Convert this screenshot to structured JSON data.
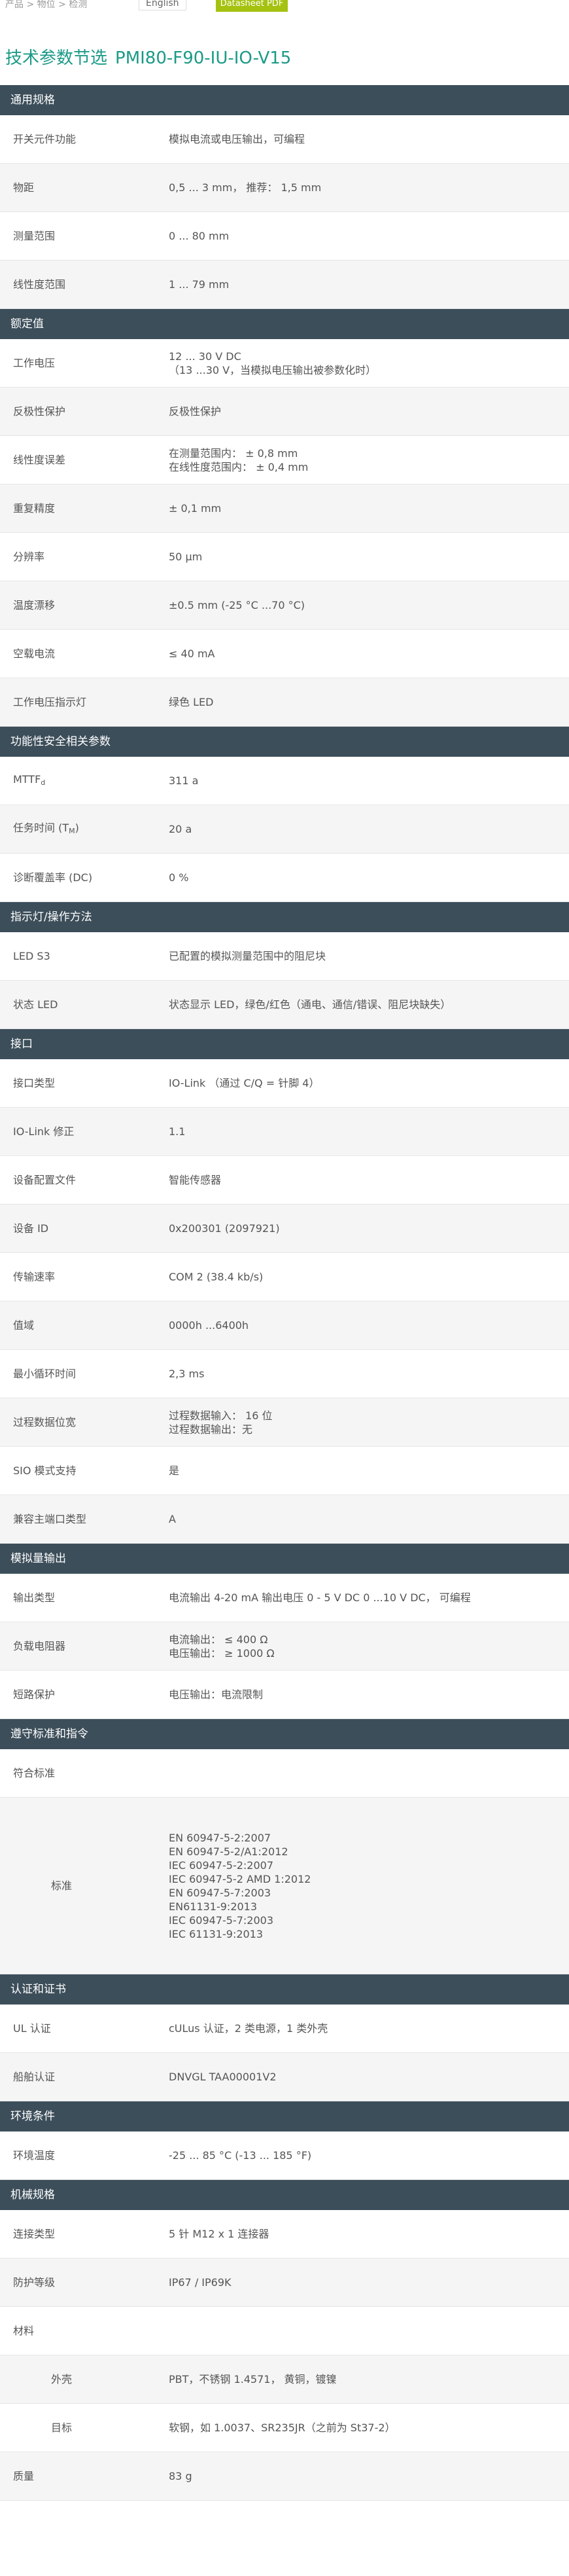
{
  "topbar": {
    "crumb": "产品 > 物位 > 检测",
    "lang": "English",
    "button": "Datasheet PDF"
  },
  "title": {
    "prefix": "技术参数节选",
    "product": "PMI80-F90-IU-IO-V15"
  },
  "sections": [
    {
      "title": "通用规格",
      "rows": [
        {
          "label": "开关元件功能",
          "values": [
            "模拟电流或电压输出，可编程"
          ]
        },
        {
          "label": "物距",
          "values": [
            "0,5 ... 3 mm， 推荐： 1,5 mm"
          ]
        },
        {
          "label": "测量范围",
          "values": [
            "0 ... 80 mm"
          ]
        },
        {
          "label": "线性度范围",
          "values": [
            "1 ... 79 mm"
          ]
        }
      ]
    },
    {
      "title": "额定值",
      "rows": [
        {
          "label": "工作电压",
          "values": [
            "12 ... 30 V DC",
            "（13 ...30 V，当模拟电压输出被参数化时）"
          ]
        },
        {
          "label": "反极性保护",
          "values": [
            "反极性保护"
          ]
        },
        {
          "label": "线性度误差",
          "values": [
            "在测量范围内： ± 0,8 mm",
            "在线性度范围内： ± 0,4 mm"
          ]
        },
        {
          "label": "重复精度",
          "values": [
            "± 0,1 mm"
          ]
        },
        {
          "label": "分辨率",
          "values": [
            "50 μm"
          ]
        },
        {
          "label": "温度漂移",
          "values": [
            "±0.5 mm (-25 °C ...70 °C)"
          ]
        },
        {
          "label": "空载电流",
          "values": [
            "≤ 40 mA"
          ]
        },
        {
          "label": "工作电压指示灯",
          "values": [
            "绿色 LED"
          ]
        }
      ]
    },
    {
      "title": "功能性安全相关参数",
      "rows": [
        {
          "label": "MTTF",
          "label_sub": "d",
          "values": [
            "311 a"
          ]
        },
        {
          "label": "任务时间 (T",
          "label_sub": "M",
          "label_suffix": ")",
          "values": [
            "20 a"
          ]
        },
        {
          "label": "诊断覆盖率 (DC)",
          "values": [
            "0 %"
          ]
        }
      ]
    },
    {
      "title": "指示灯/操作方法",
      "rows": [
        {
          "label": "LED S3",
          "values": [
            "已配置的模拟测量范围中的阻尼块"
          ]
        },
        {
          "label": "状态 LED",
          "values": [
            "状态显示 LED，绿色/红色（通电、通信/错误、阻尼块缺失）"
          ]
        }
      ]
    },
    {
      "title": "接口",
      "rows": [
        {
          "label": "接口类型",
          "values": [
            "IO-Link （通过 C/Q = 针脚 4）"
          ]
        },
        {
          "label": "IO-Link 修正",
          "values": [
            "1.1"
          ]
        },
        {
          "label": "设备配置文件",
          "values": [
            "智能传感器"
          ]
        },
        {
          "label": "设备 ID",
          "values": [
            "0x200301 (2097921)"
          ]
        },
        {
          "label": "传输速率",
          "values": [
            "COM 2 (38.4 kb/s)"
          ]
        },
        {
          "label": "值域",
          "values": [
            "0000h ...6400h"
          ]
        },
        {
          "label": "最小循环时间",
          "values": [
            "2,3 ms"
          ]
        },
        {
          "label": "过程数据位宽",
          "values": [
            "过程数据输入： 16 位",
            "过程数据输出：无"
          ]
        },
        {
          "label": "SIO 模式支持",
          "values": [
            "是"
          ]
        },
        {
          "label": "兼容主端口类型",
          "values": [
            "A"
          ]
        }
      ]
    },
    {
      "title": "模拟量输出",
      "rows": [
        {
          "label": "输出类型",
          "values": [
            "电流输出 4-20 mA 输出电压 0 - 5 V DC 0 ...10 V DC， 可编程"
          ]
        },
        {
          "label": "负载电阻器",
          "values": [
            "电流输出： ≤ 400 Ω",
            "电压输出： ≥ 1000 Ω"
          ]
        },
        {
          "label": "短路保护",
          "values": [
            "电压输出：电流限制"
          ]
        }
      ]
    },
    {
      "title": "遵守标准和指令",
      "rows": [
        {
          "label": "符合标准",
          "values": []
        },
        {
          "label": "标准",
          "indent": true,
          "values": [
            "EN 60947-5-2:2007",
            "EN 60947-5-2/A1:2012",
            "IEC 60947-5-2:2007",
            "IEC 60947-5-2 AMD 1:2012",
            "EN 60947-5-7:2003",
            "EN61131-9:2013",
            "IEC 60947-5-7:2003",
            "IEC 61131-9:2013"
          ]
        }
      ]
    },
    {
      "title": "认证和证书",
      "rows": [
        {
          "label": "UL 认证",
          "values": [
            "cULus 认证，2 类电源，1 类外壳"
          ]
        },
        {
          "label": "船舶认证",
          "values": [
            "DNVGL TAA00001V2"
          ]
        }
      ]
    },
    {
      "title": "环境条件",
      "rows": [
        {
          "label": "环境温度",
          "values": [
            "-25 ... 85 °C (-13 ... 185 °F)"
          ]
        }
      ]
    },
    {
      "title": "机械规格",
      "rows": [
        {
          "label": "连接类型",
          "values": [
            "5 针 M12 x 1 连接器"
          ]
        },
        {
          "label": "防护等级",
          "values": [
            "IP67 / IP69K"
          ]
        },
        {
          "label": "材料",
          "values": []
        },
        {
          "label": "外壳",
          "indent": true,
          "values": [
            "PBT，不锈钢 1.4571， 黄铜，镀镍"
          ]
        },
        {
          "label": "目标",
          "indent": true,
          "values": [
            "软钢，如 1.0037、SR235JR（之前为 St37-2）"
          ]
        },
        {
          "label": "质量",
          "values": [
            "83 g"
          ]
        }
      ]
    }
  ]
}
